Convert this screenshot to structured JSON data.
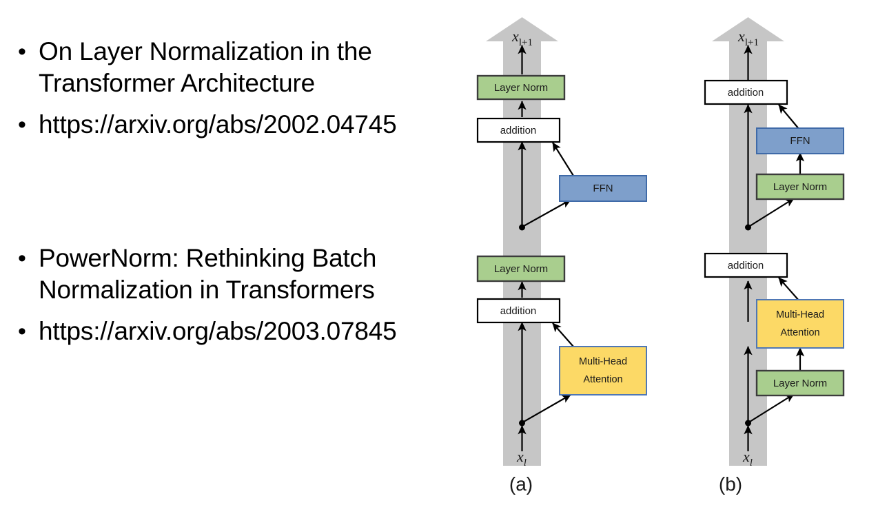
{
  "slide": {
    "bullet_groups": [
      {
        "id": "group-1",
        "bullets": [
          {
            "mark": "•",
            "text": "On Layer Normalization in the Transformer Architecture"
          },
          {
            "mark": "•",
            "text": "https://arxiv.org/abs/2002.04745"
          }
        ]
      },
      {
        "id": "group-2",
        "bullets": [
          {
            "mark": "•",
            "text": "PowerNorm: Rethinking Batch Normalization in Transformers"
          },
          {
            "mark": "•",
            "text": "https://arxiv.org/abs/2003.07845"
          }
        ]
      }
    ]
  },
  "diagram": {
    "colors": {
      "backbone_gray": "#C6C6C6",
      "layer_norm_fill": "#A9CE8E",
      "layer_norm_stroke": "#3C3C3C",
      "addition_fill": "#FFFFFF",
      "addition_stroke": "#000000",
      "ffn_fill": "#7E9FCB",
      "ffn_stroke": "#3F6AA8",
      "attention_fill": "#FCD966",
      "attention_stroke": "#4F77B5",
      "arrow_black": "#000000"
    },
    "labels": {
      "layer_norm": "Layer Norm",
      "addition": "addition",
      "ffn": "FFN",
      "multi_head_line1": "Multi-Head",
      "multi_head_line2": "Attention",
      "x_base": "x",
      "x_out_sub": "l+1",
      "x_in_sub": "l"
    },
    "panels": [
      {
        "id": "panel-a",
        "caption": "(a)",
        "architecture": "post-layer-norm",
        "blocks": [
          {
            "name": "layer-norm-top",
            "label": "Layer Norm",
            "type": "layer-norm"
          },
          {
            "name": "addition-top",
            "label": "addition",
            "type": "addition"
          },
          {
            "name": "ffn",
            "label": "FFN",
            "type": "ffn"
          },
          {
            "name": "layer-norm-bottom",
            "label": "Layer Norm",
            "type": "layer-norm"
          },
          {
            "name": "addition-bottom",
            "label": "addition",
            "type": "addition"
          },
          {
            "name": "multi-head-attention",
            "label": "Multi-Head Attention",
            "type": "attention"
          }
        ]
      },
      {
        "id": "panel-b",
        "caption": "(b)",
        "architecture": "pre-layer-norm",
        "blocks": [
          {
            "name": "addition-top",
            "label": "addition",
            "type": "addition"
          },
          {
            "name": "ffn",
            "label": "FFN",
            "type": "ffn"
          },
          {
            "name": "layer-norm-ffn",
            "label": "Layer Norm",
            "type": "layer-norm"
          },
          {
            "name": "addition-bottom",
            "label": "addition",
            "type": "addition"
          },
          {
            "name": "multi-head-attention",
            "label": "Multi-Head Attention",
            "type": "attention"
          },
          {
            "name": "layer-norm-attention",
            "label": "Layer Norm",
            "type": "layer-norm"
          }
        ]
      }
    ]
  }
}
